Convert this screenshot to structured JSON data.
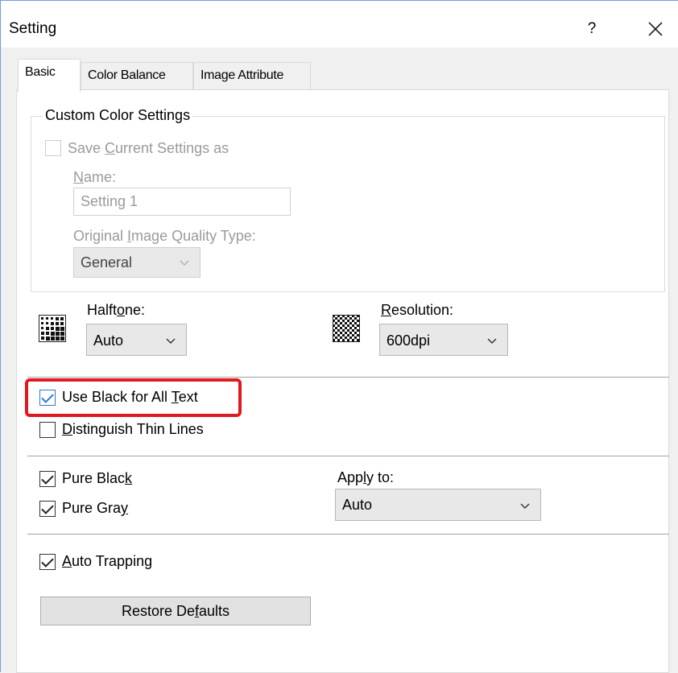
{
  "window": {
    "title": "Setting",
    "help_label": "?"
  },
  "tabs": [
    {
      "label": "Basic",
      "active": true
    },
    {
      "label": "Color Balance",
      "active": false
    },
    {
      "label": "Image Attribute",
      "active": false
    }
  ],
  "custom_color": {
    "group_label": "Custom Color Settings",
    "save_checkbox": {
      "pre": "Save ",
      "accel": "C",
      "post": "urrent Settings as",
      "checked": false,
      "enabled": false
    },
    "name_label": {
      "accel": "N",
      "post": "ame:"
    },
    "name_value": "Setting 1",
    "quality_label": {
      "pre": "Original ",
      "accel": "I",
      "post": "mage Quality Type:"
    },
    "quality_value": "General"
  },
  "halftone": {
    "label": {
      "pre": "Halft",
      "accel": "o",
      "post": "ne:"
    },
    "value": "Auto",
    "icon": "halftone-pattern-icon"
  },
  "resolution": {
    "label": {
      "pre": "",
      "accel": "R",
      "post": "esolution:"
    },
    "value": "600dpi",
    "icon": "checker-pattern-icon"
  },
  "text_options": {
    "use_black": {
      "pre": "Use Black for All ",
      "accel": "T",
      "post": "ext",
      "checked": true
    },
    "thin_lines": {
      "pre": "",
      "accel": "D",
      "post": "istinguish Thin Lines",
      "checked": false
    }
  },
  "pure": {
    "black": {
      "pre": "Pure Blac",
      "accel": "k",
      "post": "",
      "checked": true
    },
    "gray": {
      "pre": "Pure Gra",
      "accel": "y",
      "post": "",
      "checked": true
    },
    "apply_label": {
      "pre": "App",
      "accel": "l",
      "post": "y to:"
    },
    "apply_value": "Auto"
  },
  "trapping": {
    "pre": "",
    "accel": "A",
    "post": "uto Trapping",
    "checked": true
  },
  "restore_button": {
    "pre": "Restore De",
    "accel": "f",
    "post": "aults"
  },
  "colors": {
    "window_border": "#6f9fd6",
    "highlight": "#e0181f",
    "focus_check": "#2b78d4"
  }
}
